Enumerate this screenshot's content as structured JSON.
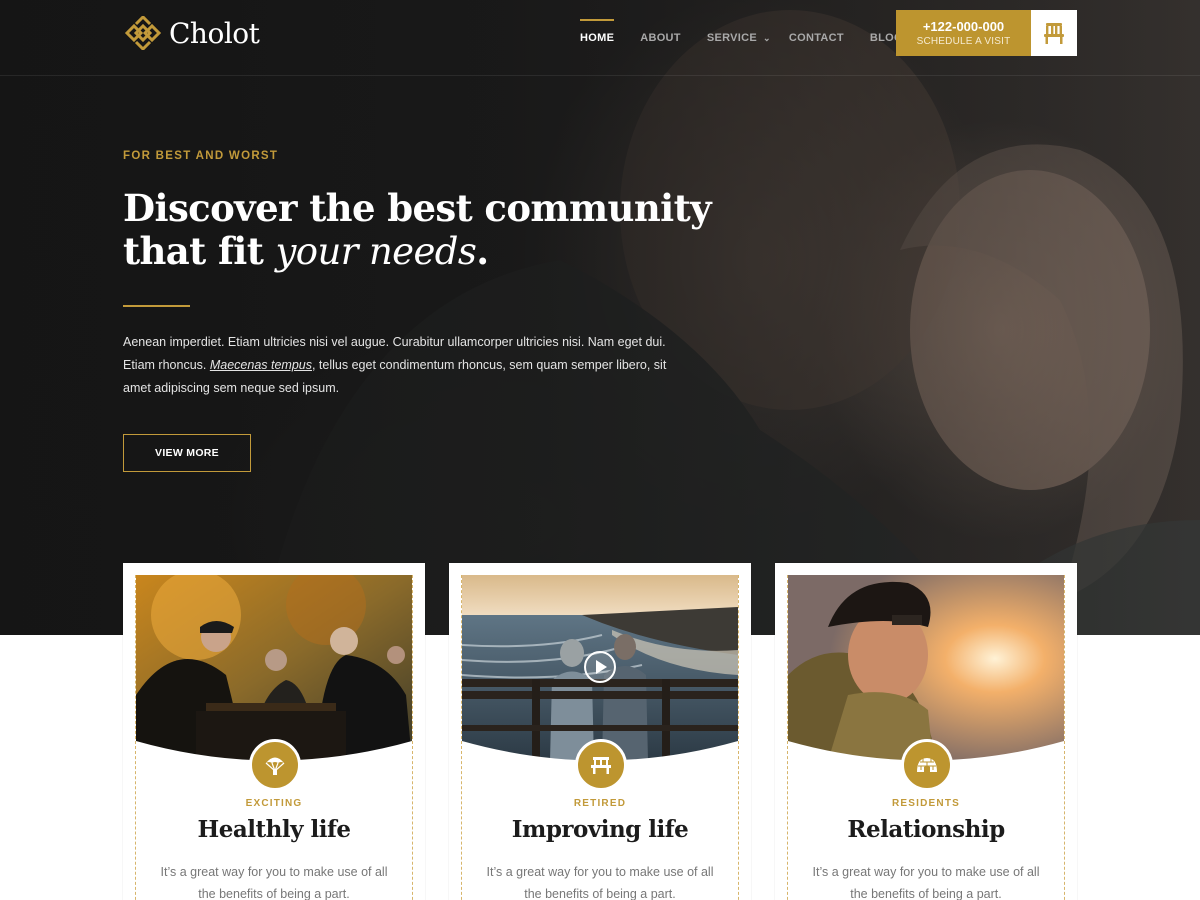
{
  "brand": {
    "name": "Cholot"
  },
  "nav": {
    "items": [
      {
        "label": "HOME",
        "active": true,
        "dropdown": false
      },
      {
        "label": "ABOUT",
        "active": false,
        "dropdown": false
      },
      {
        "label": "SERVICE",
        "active": false,
        "dropdown": true
      },
      {
        "label": "CONTACT",
        "active": false,
        "dropdown": false
      },
      {
        "label": "BLOG",
        "active": false,
        "dropdown": true
      }
    ]
  },
  "cta": {
    "phone": "+122-000-000",
    "label": "SCHEDULE A VISIT",
    "icon": "bench-icon"
  },
  "hero": {
    "eyebrow": "FOR BEST AND WORST",
    "headline_line1": "Discover the best community",
    "headline_line2_prefix": "that fit ",
    "headline_line2_italic": "your needs",
    "headline_line2_suffix": ".",
    "lead_part1": "Aenean imperdiet. Etiam ultricies nisi vel augue. Curabitur ullamcorper ultricies nisi. Nam eget dui. Etiam rhoncus. ",
    "lead_link": "Maecenas tempus",
    "lead_part2": ", tellus eget condimentum rhoncus, sem quam semper libero, sit amet adipiscing sem neque sed ipsum.",
    "button": "VIEW MORE"
  },
  "cards": [
    {
      "tag": "EXCITING",
      "title": "Healthly life",
      "text": "It’s a great way for you to make use of all the benefits of being a part.",
      "icon": "parachute-icon",
      "video": false
    },
    {
      "tag": "RETIRED",
      "title": "Improving life",
      "text": "It’s a great way for you to make use of all the benefits of being a part.",
      "icon": "bench-icon",
      "video": true
    },
    {
      "tag": "RESIDENTS",
      "title": "Relationship",
      "text": "It’s a great way for you to make use of all the benefits of being a part.",
      "icon": "igloo-icon",
      "video": false
    }
  ],
  "colors": {
    "accent": "#bd952f",
    "dark": "#1e1e1e"
  }
}
